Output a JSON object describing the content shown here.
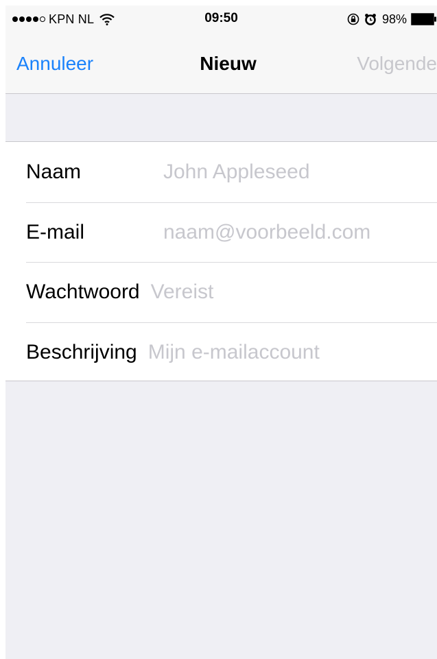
{
  "status_bar": {
    "signal_dots": 5,
    "signal_filled": 4,
    "carrier": "KPN NL",
    "time": "09:50",
    "battery_percent": "98%",
    "icons": [
      "wifi-icon",
      "rotation-lock-icon",
      "alarm-icon",
      "battery-icon"
    ]
  },
  "nav": {
    "cancel_label": "Annuleer",
    "title": "Nieuw",
    "next_label": "Volgende"
  },
  "form": {
    "fields": [
      {
        "label": "Naam",
        "placeholder": "John Appleseed"
      },
      {
        "label": "E-mail",
        "placeholder": "naam@voorbeeld.com"
      },
      {
        "label": "Wachtwoord",
        "placeholder": "Vereist"
      },
      {
        "label": "Beschrijving",
        "placeholder": "Mijn e-mailaccount"
      }
    ]
  },
  "colors": {
    "accent": "#1a82fb",
    "disabled": "#c7c7cc",
    "placeholder": "#c7c7cd",
    "background": "#efeff4",
    "bar": "#f7f7f7"
  }
}
